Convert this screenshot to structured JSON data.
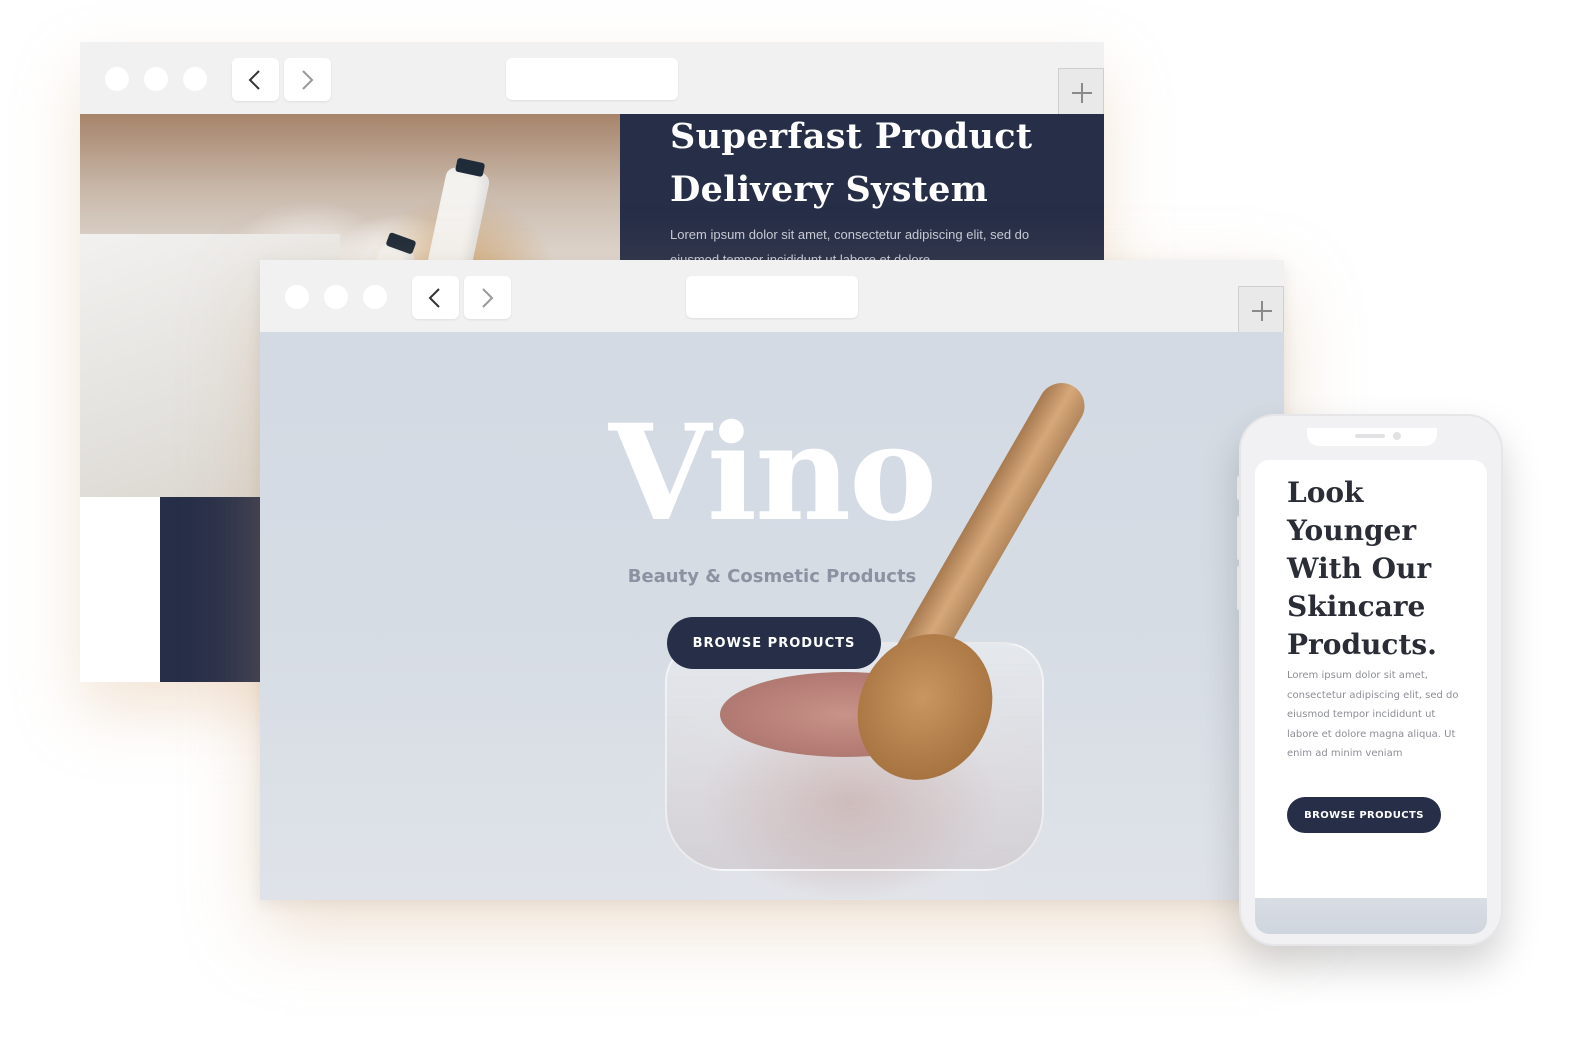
{
  "back_window": {
    "hero_title": "Superfast Product Delivery System",
    "hero_text": "Lorem ipsum dolor sit amet, consectetur adipiscing elit, sed do eiusmod tempor incididunt ut labore et dolore"
  },
  "main_window": {
    "hero_title": "Vino",
    "hero_subtitle": "Beauty & Cosmetic Products",
    "cta_label": "BROWSE PRODUCTS"
  },
  "phone": {
    "hero_title": "Look Younger With Our Skincare Products.",
    "body_text": "Lorem ipsum dolor sit amet, consectetur adipiscing elit, sed do eiusmod tempor incididunt ut labore et dolore magna aliqua. Ut enim ad minim veniam",
    "cta_label": "BROWSE PRODUCTS"
  },
  "icons": {
    "back": "chevron-left-icon",
    "forward": "chevron-right-icon",
    "new_tab": "plus-icon"
  },
  "colors": {
    "navy": "#272f48",
    "toolbar": "#f1f1f1",
    "subtitle_gray": "#8b92a2"
  }
}
